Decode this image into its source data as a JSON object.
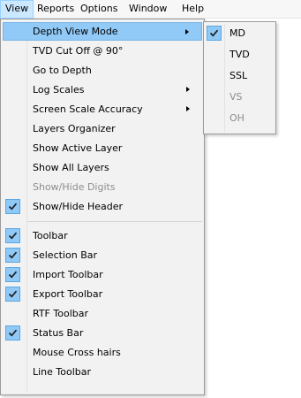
{
  "menubar": {
    "items": [
      {
        "label": "View"
      },
      {
        "label": "Reports"
      },
      {
        "label": "Options"
      },
      {
        "label": "Window"
      },
      {
        "label": "Help"
      }
    ]
  },
  "view_menu": {
    "items": [
      {
        "label": "Depth View Mode",
        "checked": false,
        "disabled": false,
        "submenu": true
      },
      {
        "label": "TVD Cut Off @ 90°",
        "checked": false,
        "disabled": false
      },
      {
        "label": "Go to Depth",
        "checked": false,
        "disabled": false
      },
      {
        "label": "Log Scales",
        "checked": false,
        "disabled": false,
        "submenu": true
      },
      {
        "label": "Screen Scale Accuracy",
        "checked": false,
        "disabled": false,
        "submenu": true
      },
      {
        "label": "Layers Organizer",
        "checked": false,
        "disabled": false
      },
      {
        "label": "Show Active Layer",
        "checked": false,
        "disabled": false
      },
      {
        "label": "Show All Layers",
        "checked": false,
        "disabled": false
      },
      {
        "label": "Show/Hide Digits",
        "checked": false,
        "disabled": true
      },
      {
        "label": "Show/Hide Header",
        "checked": true,
        "disabled": false
      },
      {
        "label": "Toolbar",
        "checked": true,
        "disabled": false
      },
      {
        "label": "Selection Bar",
        "checked": true,
        "disabled": false
      },
      {
        "label": "Import Toolbar",
        "checked": true,
        "disabled": false
      },
      {
        "label": "Export Toolbar",
        "checked": true,
        "disabled": false
      },
      {
        "label": "RTF Toolbar",
        "checked": false,
        "disabled": false
      },
      {
        "label": "Status Bar",
        "checked": true,
        "disabled": false
      },
      {
        "label": "Mouse Cross hairs",
        "checked": false,
        "disabled": false
      },
      {
        "label": "Line Toolbar",
        "checked": false,
        "disabled": false
      }
    ]
  },
  "depth_view_submenu": {
    "items": [
      {
        "label": "MD",
        "checked": true,
        "disabled": false
      },
      {
        "label": "TVD",
        "checked": false,
        "disabled": false
      },
      {
        "label": "SSL",
        "checked": false,
        "disabled": false
      },
      {
        "label": "VS",
        "checked": false,
        "disabled": true
      },
      {
        "label": "OH",
        "checked": false,
        "disabled": true
      }
    ]
  },
  "icons": {
    "check": "checkmark-icon",
    "submenu_arrow": "submenu-arrow-icon"
  },
  "colors": {
    "highlight": "#91c9f7",
    "check_bg": "#90c8f6",
    "disabled_text": "#8d8d8d"
  }
}
